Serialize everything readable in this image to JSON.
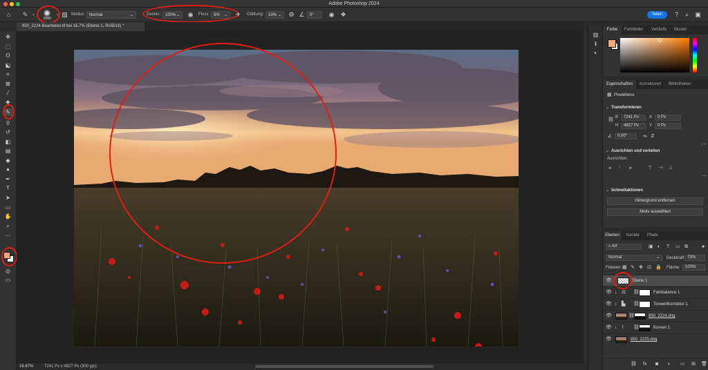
{
  "window": {
    "title": "Adobe Photoshop 2024"
  },
  "options_bar": {
    "brush_size": "5000",
    "mode_label": "Modus:",
    "mode_value": "Normal",
    "opacity_label": "Deckkr.:",
    "opacity_value": "100%",
    "flow_label": "Fluss:",
    "flow_value": "5%",
    "smoothing_label": "Glättung:",
    "smoothing_value": "10%",
    "angle_value": "0°",
    "share_label": "Teilen"
  },
  "document": {
    "tab_title": "850_2224-Bearbeitet.tif bei 16,7% (Ebene 1, RGB/16) *",
    "zoom": "16.67%",
    "info": "7241 Px x 4827 Px (300 ppi)"
  },
  "color_panel": {
    "tabs": [
      "Farbe",
      "Farbfelder",
      "Verläufe",
      "Muster"
    ]
  },
  "properties_panel": {
    "tabs": [
      "Eigenschaften",
      "Korrekturen",
      "Bibliotheken"
    ],
    "layer_type": "Pixelebene",
    "transform_title": "Transformieren",
    "w_label": "B",
    "w_value": "7241 Px",
    "h_label": "H",
    "h_value": "4827 Px",
    "x_label": "X",
    "x_value": "0 Px",
    "y_label": "Y",
    "y_value": "0 Px",
    "angle_value": "0,00°",
    "align_title": "Ausrichten und verteilen",
    "align_sub": "Ausrichten:",
    "quick_title": "Schnellaktionen",
    "remove_bg": "Hintergrund entfernen",
    "select_subject": "Motiv auswählen"
  },
  "layers_panel": {
    "tabs": [
      "Ebenen",
      "Kanäle",
      "Pfade"
    ],
    "filter_value": "Art",
    "blend_mode": "Normal",
    "opacity_label": "Deckkraft:",
    "opacity_value": "73%",
    "lock_label": "Fixieren:",
    "fill_label": "Fläche:",
    "fill_value": "100%",
    "layers": [
      {
        "name": "Ebene 1"
      },
      {
        "name": "Farbbalance 1"
      },
      {
        "name": "Tonwertkorrektur 1"
      },
      {
        "name": "850_2224.dng"
      },
      {
        "name": "Kurven 1"
      },
      {
        "name": "850_2225.dng"
      }
    ]
  },
  "colors": {
    "accent": "#1473e6",
    "annotation": "#e01f10",
    "foreground": "#f0a878",
    "background": "#ffffff"
  }
}
